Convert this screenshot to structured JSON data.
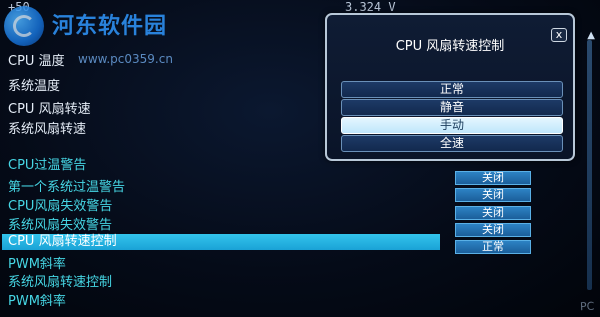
{
  "top_values": [
    "+50",
    "3.324 V"
  ],
  "watermark": {
    "title": "河东软件园",
    "url": "www.pc0359.cn",
    "bottom": "PC"
  },
  "left_list": [
    {
      "label": "CPU 温度"
    },
    {
      "label": "系统温度"
    },
    {
      "label": "CPU 风扇转速"
    },
    {
      "label": "系统风扇转速"
    }
  ],
  "warning_list": [
    {
      "label": "CPU过温警告",
      "value": ""
    },
    {
      "label": "第一个系统过温警告",
      "value": "关闭"
    },
    {
      "label": "CPU风扇失效警告",
      "value": "关闭"
    },
    {
      "label": "系统风扇失效警告",
      "value": "关闭"
    },
    {
      "label": "CPU 风扇转速控制",
      "value": "正常",
      "selected": true
    },
    {
      "label": "PWM斜率",
      "value": ""
    },
    {
      "label": "系统风扇转速控制",
      "value": ""
    },
    {
      "label": "PWM斜率",
      "value": ""
    }
  ],
  "extra_value": "关闭",
  "popup": {
    "title": "CPU 风扇转速控制",
    "close_label": "x",
    "options": [
      "正常",
      "静音",
      "手动",
      "全速"
    ],
    "selected_index": 2
  },
  "colors": {
    "highlight": "#1aa2d6",
    "button": "#1b5e9a",
    "cyan_text": "#46d6e4"
  }
}
